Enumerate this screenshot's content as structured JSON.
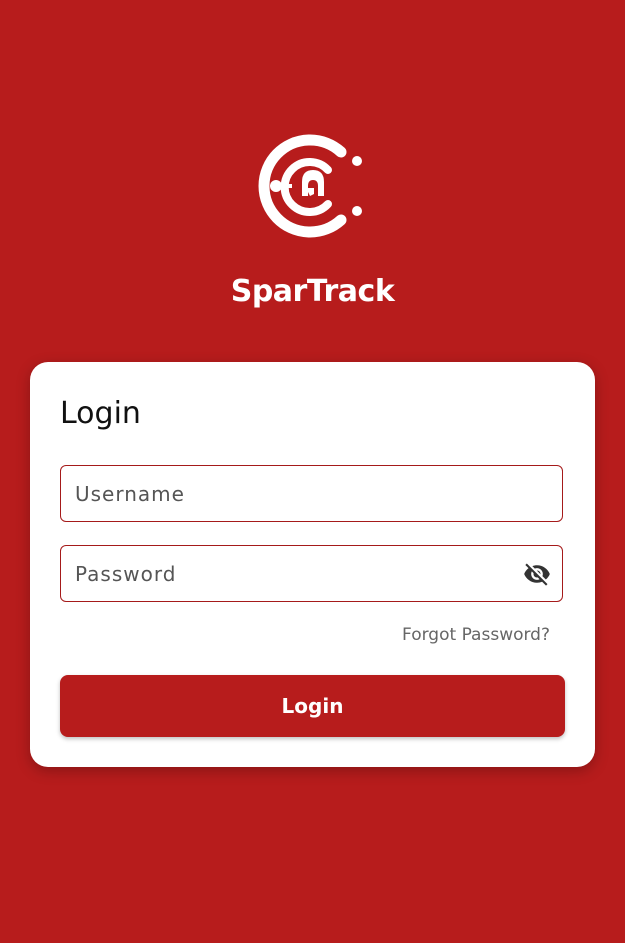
{
  "app": {
    "name": "SparTrack",
    "logo_icon": "spartrack-logo-icon"
  },
  "login_card": {
    "title": "Login",
    "username_placeholder": "Username",
    "username_value": "",
    "password_placeholder": "Password",
    "password_value": "",
    "visibility_icon": "eye-off-icon",
    "forgot_password_label": "Forgot Password?",
    "login_button_label": "Login"
  },
  "colors": {
    "background": "#b71c1c",
    "card": "#ffffff",
    "field_border": "#a51a1a",
    "button": "#b71c1c",
    "button_text": "#ffffff"
  }
}
